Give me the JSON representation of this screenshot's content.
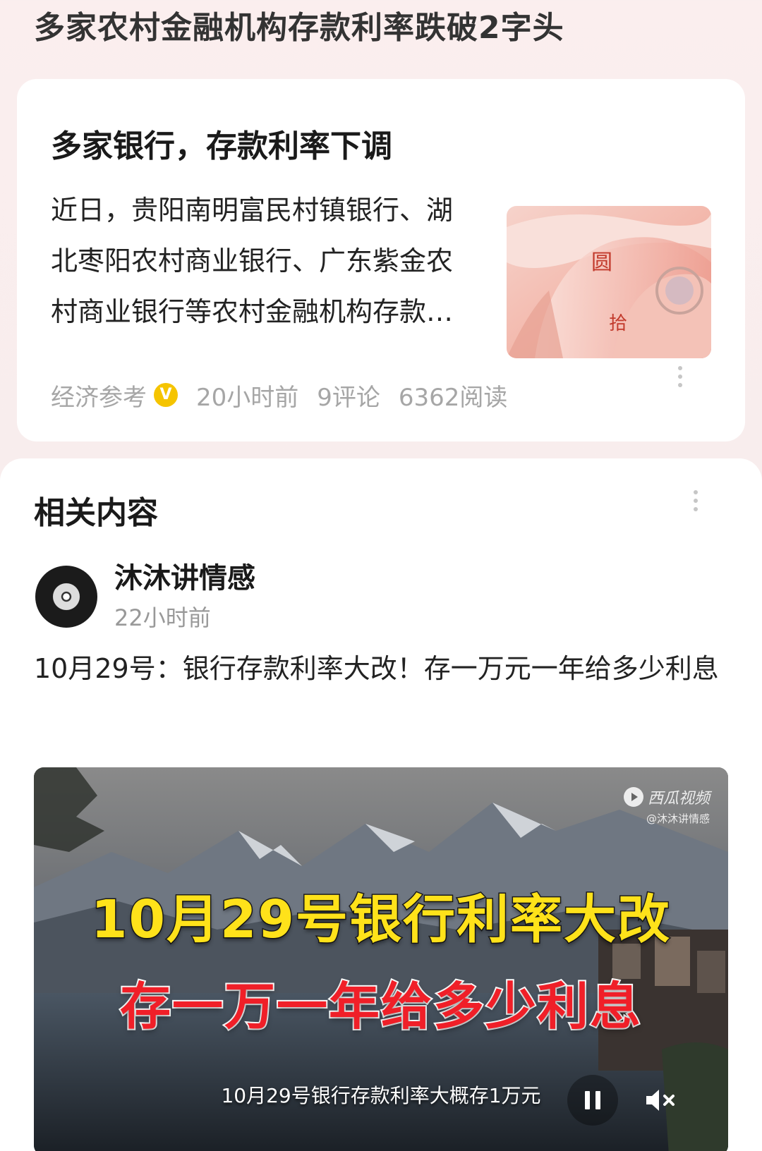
{
  "page": {
    "title": "多家农村金融机构存款利率跌破2字头"
  },
  "article_card": {
    "title": "多家银行，存款利率下调",
    "summary": "近日，贵阳南明富民村镇银行、湖北枣阳农村商业银行、广东紫金农村商业银行等农村金融机构存款利率下调",
    "thumbnail_icon": "rmb-banknotes-image",
    "meta": {
      "source": "经济参考",
      "verified_badge": "V",
      "time": "20小时前",
      "comments": "9评论",
      "reads": "6362阅读"
    },
    "more_icon": "more-vertical-icon"
  },
  "related": {
    "title": "相关内容",
    "more_icon": "more-vertical-icon",
    "post": {
      "author": "沐沐讲情感",
      "time": "22小时前",
      "avatar_icon": "vinyl-record-avatar",
      "text": "10月29号：银行存款利率大改！存一万元一年给多少利息",
      "video": {
        "platform": "西瓜视频",
        "handle": "@沐沐讲情感",
        "caption_line1": "10月29号银行利率大改",
        "caption_line2": "存一万一年给多少利息",
        "subtitle": "10月29号银行存款利率大概存1万元",
        "pause_icon": "pause-icon",
        "mute_icon": "mute-icon"
      }
    }
  },
  "colors": {
    "caption_yellow": "#ffe21a",
    "caption_red": "#f01f28",
    "verified_badge": "#f5c400",
    "meta_gray": "#a6a6a6"
  }
}
